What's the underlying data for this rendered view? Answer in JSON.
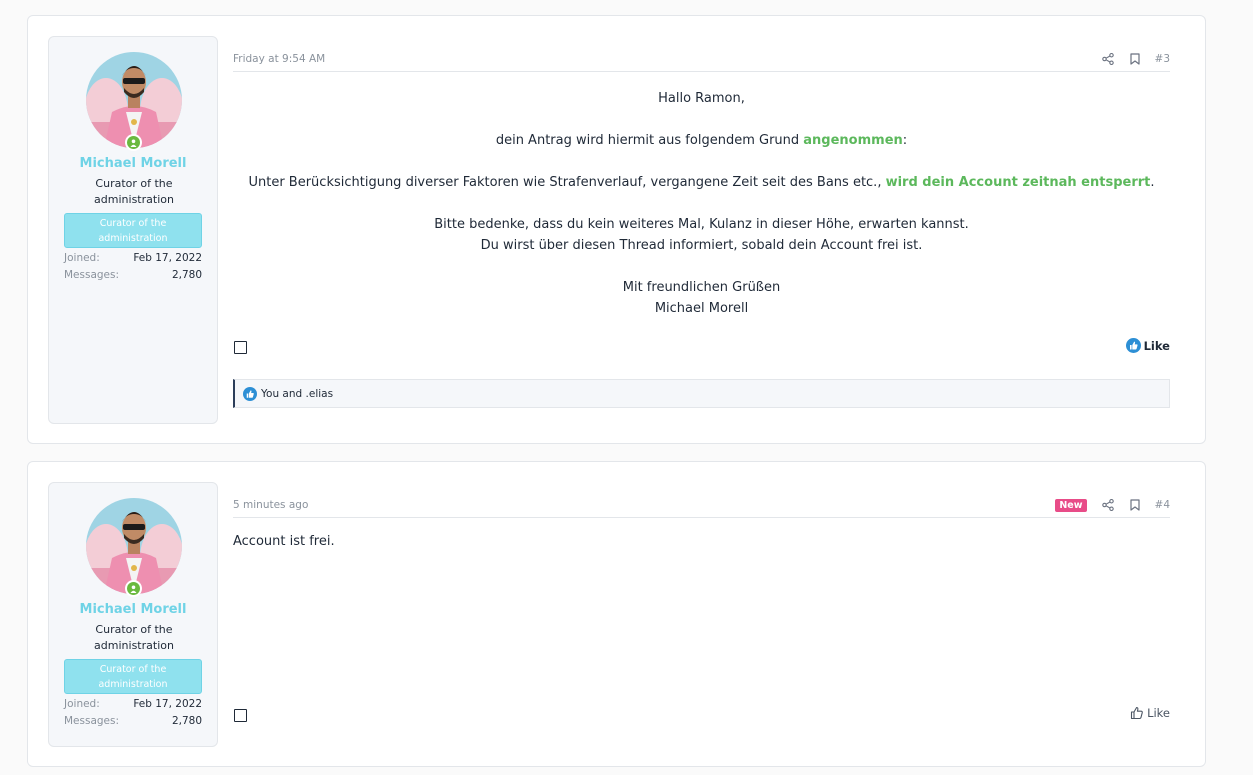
{
  "posts": [
    {
      "user": {
        "name": "Michael Morell",
        "title": "Curator of the administration",
        "banner": "Curator of the administration",
        "joined_label": "Joined:",
        "joined_value": "Feb 17, 2022",
        "messages_label": "Messages:",
        "messages_value": "2,780"
      },
      "date": "Friday at 9:54 AM",
      "number": "#3",
      "body": {
        "greeting": "Hallo Ramon,",
        "line2_pre": "dein Antrag wird hiermit aus folgendem Grund ",
        "line2_highlight": "angenommen",
        "line2_post": ":",
        "line3_pre": "Unter Berücksichtigung diverser Faktoren wie Strafenverlauf, vergangene Zeit seit des Bans etc., ",
        "line3_highlight": "wird dein Account zeitnah entsperrt",
        "line3_post": ".",
        "line4": "Bitte bedenke, dass du kein weiteres Mal, Kulanz in dieser Höhe, erwarten kannst.",
        "line5": "Du wirst über diesen Thread informiert, sobald dein Account frei ist.",
        "closing": "Mit freundlichen Grüßen",
        "signature": "Michael Morell"
      },
      "like_label": "Like",
      "reactions_text": "You and .elias"
    },
    {
      "user": {
        "name": "Michael Morell",
        "title": "Curator of the administration",
        "banner": "Curator of the administration",
        "joined_label": "Joined:",
        "joined_value": "Feb 17, 2022",
        "messages_label": "Messages:",
        "messages_value": "2,780"
      },
      "date": "5 minutes ago",
      "badge": "New",
      "number": "#4",
      "body": "Account ist frei.",
      "like_label": "Like"
    }
  ],
  "colors": {
    "username": "#6fd3e6",
    "banner": "#8fe1ee",
    "highlight": "#5cb85c",
    "new_badge": "#e84c88",
    "online": "#6ab93f",
    "like_blue": "#2d8fd5"
  },
  "icons": [
    "share-icon",
    "bookmark-icon",
    "thumbs-up-icon",
    "online-status-icon"
  ]
}
